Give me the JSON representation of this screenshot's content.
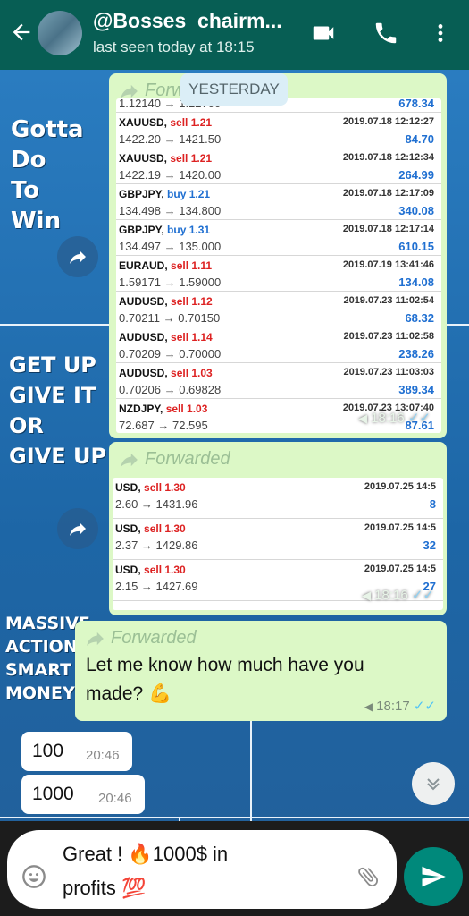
{
  "header": {
    "title": "@Bosses_chairm...",
    "subtitle": "last seen today at 18:15",
    "icons": [
      "back-arrow-icon",
      "video-call-icon",
      "phone-icon",
      "more-options-icon"
    ]
  },
  "wallpaper": {
    "line1": "Gotta",
    "line2": "Do",
    "line3": "To",
    "line4": "Win",
    "line5": "GET UP",
    "line6": "GIVE IT",
    "line7": "OR",
    "line8": "GIVE UP",
    "line9": "MASSIVE",
    "line10": "ACTION",
    "line11": "SMART",
    "line12": "MONEY"
  },
  "date_pill": "YESTERDAY",
  "messages": {
    "msg1": {
      "forwarded_label": "Forwarded",
      "time": "18:16",
      "partial_top": "1.12140 → 1.12700",
      "partial_top_profit": "678.34",
      "rows": [
        {
          "symbol": "XAUUSD,",
          "side": "sell 1.21",
          "side_type": "sell",
          "date": "2019.07.18 12:12:27",
          "prices": "1422.20 → 1421.50",
          "profit": "84.70"
        },
        {
          "symbol": "XAUUSD,",
          "side": "sell 1.21",
          "side_type": "sell",
          "date": "2019.07.18 12:12:34",
          "prices": "1422.19 → 1420.00",
          "profit": "264.99"
        },
        {
          "symbol": "GBPJPY,",
          "side": "buy 1.21",
          "side_type": "buy",
          "date": "2019.07.18 12:17:09",
          "prices": "134.498 → 134.800",
          "profit": "340.08"
        },
        {
          "symbol": "GBPJPY,",
          "side": "buy 1.31",
          "side_type": "buy",
          "date": "2019.07.18 12:17:14",
          "prices": "134.497 → 135.000",
          "profit": "610.15"
        },
        {
          "symbol": "EURAUD,",
          "side": "sell 1.11",
          "side_type": "sell",
          "date": "2019.07.19 13:41:46",
          "prices": "1.59171 → 1.59000",
          "profit": "134.08"
        },
        {
          "symbol": "AUDUSD,",
          "side": "sell 1.12",
          "side_type": "sell",
          "date": "2019.07.23 11:02:54",
          "prices": "0.70211 → 0.70150",
          "profit": "68.32"
        },
        {
          "symbol": "AUDUSD,",
          "side": "sell 1.14",
          "side_type": "sell",
          "date": "2019.07.23 11:02:58",
          "prices": "0.70209 → 0.70000",
          "profit": "238.26"
        },
        {
          "symbol": "AUDUSD,",
          "side": "sell 1.03",
          "side_type": "sell",
          "date": "2019.07.23 11:03:03",
          "prices": "0.70206 → 0.69828",
          "profit": "389.34"
        },
        {
          "symbol": "NZDJPY,",
          "side": "sell 1.03",
          "side_type": "sell",
          "date": "2019.07.23 13:07:40",
          "prices": "72.687 → 72.595",
          "profit": "87.61"
        }
      ]
    },
    "msg2": {
      "forwarded_label": "Forwarded",
      "time": "18:16",
      "rows": [
        {
          "symbol": "USD,",
          "side": "sell 1.30",
          "side_type": "sell",
          "date": "2019.07.25 14:5",
          "prices": "2.60 → 1431.96",
          "profit": "8"
        },
        {
          "symbol": "USD,",
          "side": "sell 1.30",
          "side_type": "sell",
          "date": "2019.07.25 14:5",
          "prices": "2.37 → 1429.86",
          "profit": "32"
        },
        {
          "symbol": "USD,",
          "side": "sell 1.30",
          "side_type": "sell",
          "date": "2019.07.25 14:5",
          "prices": "2.15 → 1427.69",
          "profit": "27"
        }
      ]
    },
    "msg3": {
      "forwarded_label": "Forwarded",
      "text_line1": "Let me know how much have you",
      "text_line2": "made? 💪",
      "time": "18:17"
    },
    "msg4": {
      "text": "100",
      "time": "20:46"
    },
    "msg5": {
      "text": "1000",
      "time": "20:46"
    }
  },
  "composer": {
    "value": "Great ! 🔥1000$ in\nprofits 💯",
    "icons": [
      "emoji-icon",
      "attach-icon"
    ]
  },
  "send_icon": "send-icon",
  "colors": {
    "header": "#075e54",
    "bubble_out": "#dcf8c6",
    "bubble_in": "#ffffff",
    "send": "#00897b",
    "read_ticks": "#4fc3f7"
  }
}
